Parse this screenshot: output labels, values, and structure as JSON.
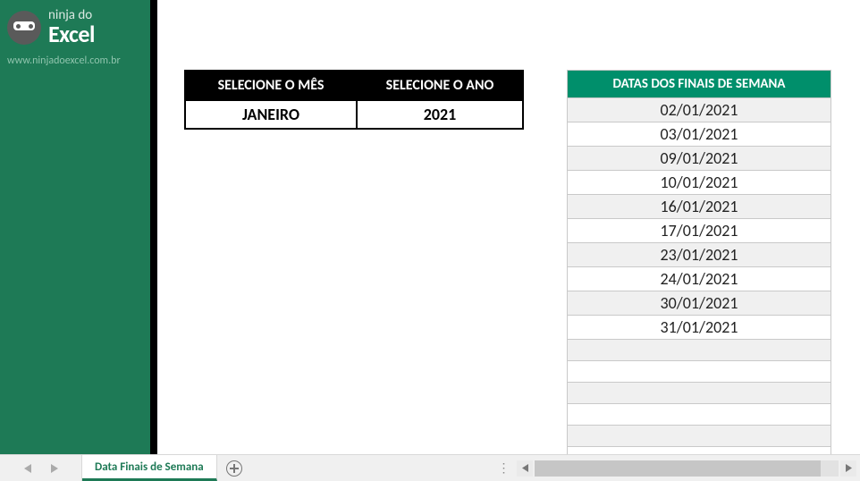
{
  "brand": {
    "line1": "ninja do",
    "line2": "Excel",
    "url": "www.ninjadoexcel.com.br"
  },
  "selector": {
    "header_mes": "SELECIONE O MÊS",
    "header_ano": "SELECIONE O ANO",
    "mes_value": "JANEIRO",
    "ano_value": "2021"
  },
  "dates": {
    "header": "DATAS DOS FINAIS DE SEMANA",
    "rows": [
      "02/01/2021",
      "03/01/2021",
      "09/01/2021",
      "10/01/2021",
      "16/01/2021",
      "17/01/2021",
      "23/01/2021",
      "24/01/2021",
      "30/01/2021",
      "31/01/2021",
      "",
      "",
      "",
      "",
      "",
      ""
    ]
  },
  "tabs": {
    "sheet1": "Data Finais de Semana"
  }
}
